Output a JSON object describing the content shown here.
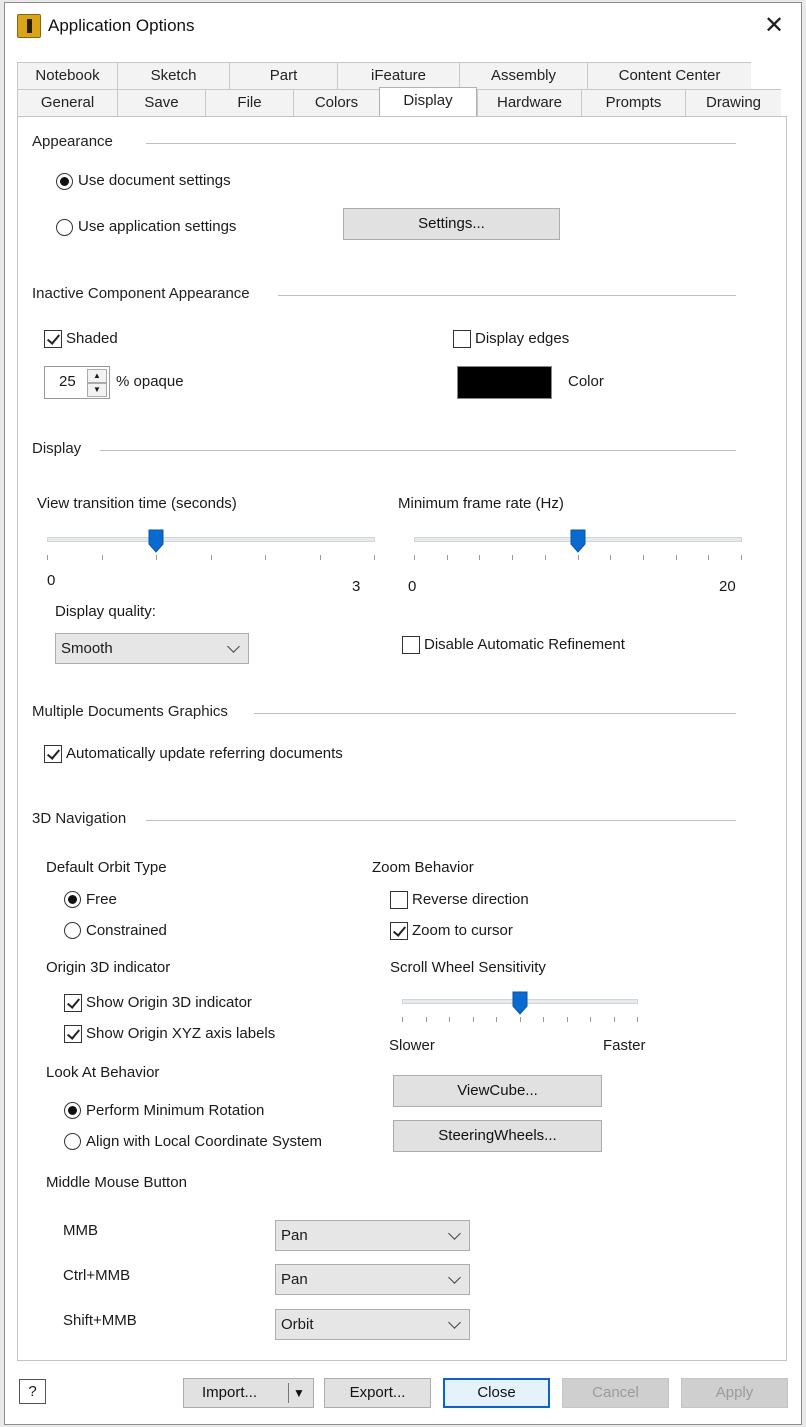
{
  "window": {
    "title": "Application Options",
    "close_glyph": "✕"
  },
  "tabs_row1": [
    "Notebook",
    "Sketch",
    "Part",
    "iFeature",
    "Assembly",
    "Content Center"
  ],
  "tabs_row2": [
    "General",
    "Save",
    "File",
    "Colors",
    "Display",
    "Hardware",
    "Prompts",
    "Drawing"
  ],
  "active_tab": "Display",
  "appearance": {
    "heading": "Appearance",
    "use_document": "Use document settings",
    "use_application": "Use application settings",
    "settings_button": "Settings..."
  },
  "inactive": {
    "heading": "Inactive Component Appearance",
    "shaded": "Shaded",
    "display_edges": "Display edges",
    "opacity_value": "25",
    "opacity_label": "% opaque",
    "color_label": "Color",
    "swatch_color": "#000000"
  },
  "display": {
    "heading": "Display",
    "view_transition_label": "View transition time (seconds)",
    "view_transition_min": "0",
    "view_transition_max": "3",
    "view_transition_value": 1,
    "min_frame_label": "Minimum frame rate (Hz)",
    "min_frame_min": "0",
    "min_frame_max": "20",
    "min_frame_value": 10,
    "quality_label": "Display quality:",
    "quality_value": "Smooth",
    "disable_refinement": "Disable Automatic Refinement"
  },
  "multi_docs": {
    "heading": "Multiple Documents Graphics",
    "auto_update": "Automatically update referring documents"
  },
  "nav3d": {
    "heading": "3D Navigation",
    "orbit_heading": "Default Orbit Type",
    "orbit_free": "Free",
    "orbit_constrained": "Constrained",
    "origin_heading": "Origin 3D indicator",
    "show_origin": "Show Origin 3D indicator",
    "show_xyz": "Show Origin XYZ axis labels",
    "lookat_heading": "Look At Behavior",
    "min_rotation": "Perform Minimum Rotation",
    "align_local": "Align with Local Coordinate System",
    "zoom_heading": "Zoom Behavior",
    "reverse_direction": "Reverse direction",
    "zoom_cursor": "Zoom to cursor",
    "scroll_heading": "Scroll Wheel Sensitivity",
    "scroll_slower": "Slower",
    "scroll_faster": "Faster",
    "scroll_value": 0.5,
    "viewcube_button": "ViewCube...",
    "steering_button": "SteeringWheels..."
  },
  "mmb": {
    "heading": "Middle Mouse Button",
    "rows": [
      {
        "label": "MMB",
        "value": "Pan"
      },
      {
        "label": "Ctrl+MMB",
        "value": "Pan"
      },
      {
        "label": "Shift+MMB",
        "value": "Orbit"
      }
    ]
  },
  "footer": {
    "help_glyph": "?",
    "import": "Import...",
    "export": "Export...",
    "close": "Close",
    "cancel": "Cancel",
    "apply": "Apply"
  },
  "colors": {
    "accent": "#0a64c8",
    "slider_thumb": "#0a6ad0"
  }
}
